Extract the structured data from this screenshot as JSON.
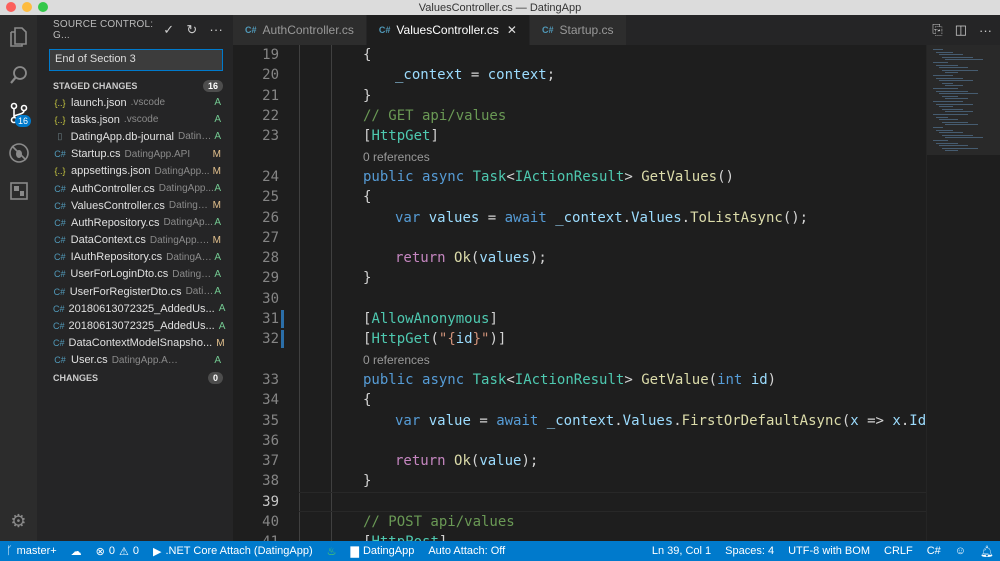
{
  "window": {
    "title": "ValuesController.cs — DatingApp"
  },
  "colors": {
    "accent": "#007acc",
    "sidebar": "#252526",
    "editor": "#1e1e1e"
  },
  "activity": {
    "scm_badge": "16"
  },
  "sidebar": {
    "title": "SOURCE CONTROL: G...",
    "commit_message": "End of Section 3",
    "staged_header": "STAGED CHANGES",
    "staged_count": "16",
    "changes_header": "CHANGES",
    "changes_count": "0",
    "files": [
      {
        "icon": "json-icon",
        "name": "launch.json",
        "path": ".vscode",
        "status": "A"
      },
      {
        "icon": "json-icon",
        "name": "tasks.json",
        "path": ".vscode",
        "status": "A"
      },
      {
        "icon": "file-icon",
        "name": "DatingApp.db-journal",
        "path": "Dating...",
        "status": "A"
      },
      {
        "icon": "csharp-icon",
        "name": "Startup.cs",
        "path": "DatingApp.API",
        "status": "M"
      },
      {
        "icon": "json-icon",
        "name": "appsettings.json",
        "path": "DatingApp...",
        "status": "M"
      },
      {
        "icon": "csharp-icon",
        "name": "AuthController.cs",
        "path": "DatingApp...",
        "status": "A"
      },
      {
        "icon": "csharp-icon",
        "name": "ValuesController.cs",
        "path": "DatingA...",
        "status": "M"
      },
      {
        "icon": "csharp-icon",
        "name": "AuthRepository.cs",
        "path": "DatingAp...",
        "status": "A"
      },
      {
        "icon": "csharp-icon",
        "name": "DataContext.cs",
        "path": "DatingApp.A...",
        "status": "M"
      },
      {
        "icon": "csharp-icon",
        "name": "IAuthRepository.cs",
        "path": "DatingAp...",
        "status": "A"
      },
      {
        "icon": "csharp-icon",
        "name": "UserForLoginDto.cs",
        "path": "DatingA...",
        "status": "A"
      },
      {
        "icon": "csharp-icon",
        "name": "UserForRegisterDto.cs",
        "path": "Datin...",
        "status": "A"
      },
      {
        "icon": "csharp-icon",
        "name": "20180613072325_AddedUs...",
        "path": "",
        "status": "A"
      },
      {
        "icon": "csharp-icon",
        "name": "20180613072325_AddedUs...",
        "path": "",
        "status": "A"
      },
      {
        "icon": "csharp-icon",
        "name": "DataContextModelSnapsho...",
        "path": "",
        "status": "M"
      },
      {
        "icon": "csharp-icon",
        "name": "User.cs",
        "path": "DatingApp.API/Models",
        "status": "A"
      }
    ]
  },
  "tabs": [
    {
      "label": "AuthController.cs",
      "active": false
    },
    {
      "label": "ValuesController.cs",
      "active": true
    },
    {
      "label": "Startup.cs",
      "active": false
    }
  ],
  "editor": {
    "lines": [
      {
        "n": "19",
        "code": "{"
      },
      {
        "n": "20",
        "code": "_context = context;"
      },
      {
        "n": "21",
        "code": "}"
      },
      {
        "n": "22",
        "code": "// GET api/values"
      },
      {
        "n": "23",
        "code": "[HttpGet]"
      },
      {
        "lens": "0 references"
      },
      {
        "n": "24",
        "code": "public async Task<IActionResult> GetValues()"
      },
      {
        "n": "25",
        "code": "{"
      },
      {
        "n": "26",
        "code": "var values = await _context.Values.ToListAsync();"
      },
      {
        "n": "27",
        "code": ""
      },
      {
        "n": "28",
        "code": "return Ok(values);"
      },
      {
        "n": "29",
        "code": "}"
      },
      {
        "n": "30",
        "code": ""
      },
      {
        "n": "31",
        "code": "[AllowAnonymous]"
      },
      {
        "n": "32",
        "code": "[HttpGet(\"{id}\")]"
      },
      {
        "lens": "0 references"
      },
      {
        "n": "33",
        "code": "public async Task<IActionResult> GetValue(int id)"
      },
      {
        "n": "34",
        "code": "{"
      },
      {
        "n": "35",
        "code": "var value = await _context.Values.FirstOrDefaultAsync(x => x.Id =="
      },
      {
        "n": "36",
        "code": ""
      },
      {
        "n": "37",
        "code": "return Ok(value);"
      },
      {
        "n": "38",
        "code": "}"
      },
      {
        "n": "39",
        "code": ""
      },
      {
        "n": "40",
        "code": "// POST api/values"
      },
      {
        "n": "41",
        "code": "[HttpPost]"
      }
    ]
  },
  "status": {
    "branch": "master+",
    "errors": "0",
    "warnings": "0",
    "debug": ".NET Core Attach (DatingApp)",
    "folder": "DatingApp",
    "auto_attach": "Auto Attach: Off",
    "position": "Ln 39, Col 1",
    "spaces": "Spaces: 4",
    "encoding": "UTF-8 with BOM",
    "eol": "CRLF",
    "language": "C#"
  }
}
